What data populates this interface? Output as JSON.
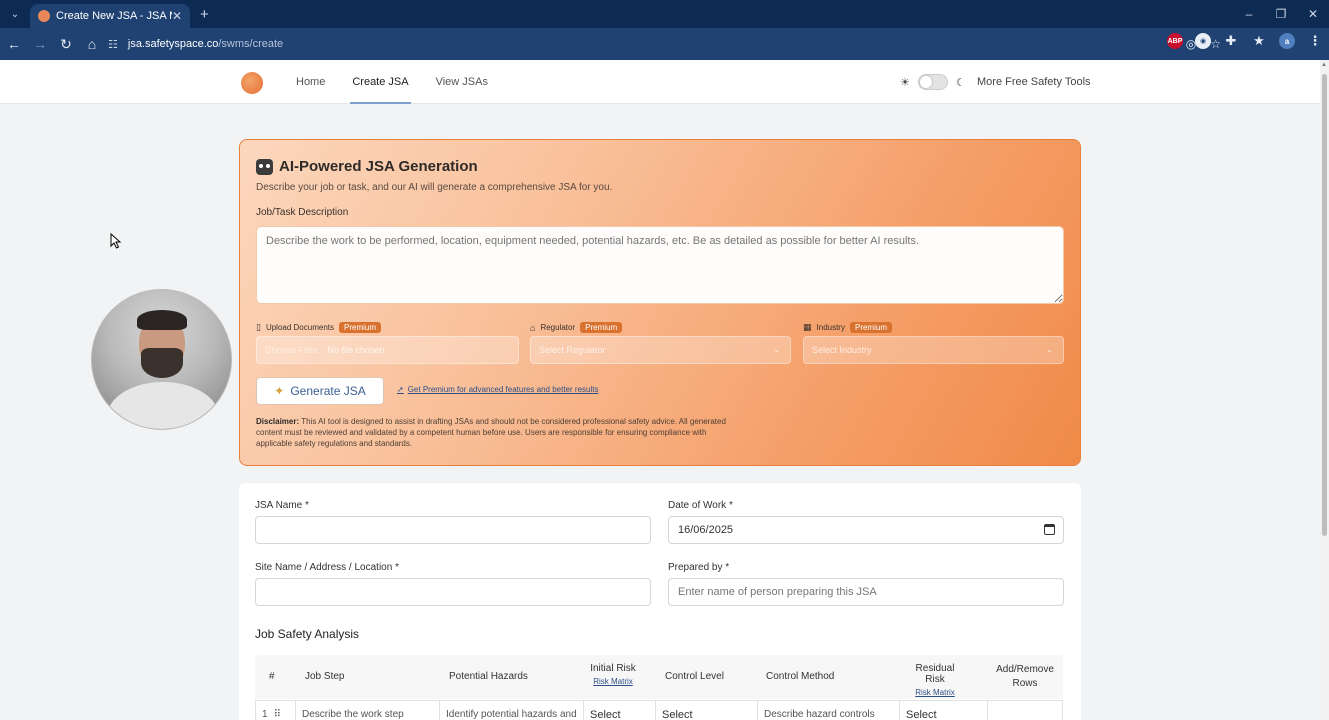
{
  "browser": {
    "tab_title": "Create New JSA - JSA Maker",
    "url_host": "jsa.safetyspace.co",
    "url_path": "/swms/create",
    "avatar_letter": "a",
    "ext_abp": "ABP"
  },
  "header": {
    "nav": [
      "Home",
      "Create JSA",
      "View JSAs"
    ],
    "active_nav": "Create JSA",
    "more_tools": "More Free Safety Tools",
    "sun_glyph": "☀",
    "moon_glyph": "☾"
  },
  "ai_card": {
    "title": "AI-Powered JSA Generation",
    "subtitle": "Describe your job or task, and our AI will generate a comprehensive JSA for you.",
    "task_label": "Job/Task Description",
    "task_placeholder": "Describe the work to be performed, location, equipment needed, potential hazards, etc. Be as detailed as possible for better AI results.",
    "upload_label": "Upload Documents",
    "regulator_label": "Regulator",
    "industry_label": "Industry",
    "premium_badge": "Premium",
    "choose_file": "Choose Files",
    "no_file": "No file chosen",
    "regulator_placeholder": "Select Regulator",
    "industry_placeholder": "Select Industry",
    "generate_button": "Generate JSA",
    "premium_link": "Get Premium for advanced features and better results",
    "disclaimer_label": "Disclaimer:",
    "disclaimer_text": "This AI tool is designed to assist in drafting JSAs and should not be considered professional safety advice. All generated content must be reviewed and validated by a competent human before use. Users are responsible for ensuring compliance with applicable safety regulations and standards."
  },
  "form": {
    "jsa_name_label": "JSA Name *",
    "jsa_name_value": "",
    "date_label": "Date of Work *",
    "date_value": "16/06/2025",
    "site_label": "Site Name / Address / Location *",
    "site_value": "",
    "prepared_label": "Prepared by *",
    "prepared_placeholder": "Enter name of person preparing this JSA",
    "section_title": "Job Safety Analysis",
    "columns": {
      "num": "#",
      "job_step": "Job Step",
      "hazards": "Potential Hazards",
      "initial_risk": "Initial Risk",
      "risk_matrix": "Risk Matrix",
      "control_level": "Control Level",
      "control_method": "Control Method",
      "residual_risk": "Residual Risk",
      "add_remove": "Add/Remove Rows"
    },
    "row1": {
      "num": "1",
      "job_step": "Describe the work step",
      "hazards": "Identify potential hazards and",
      "initial": "Select",
      "control_level": "Select",
      "control_method": "Describe hazard controls",
      "residual": "Select"
    }
  },
  "colors": {
    "brand_orange": "#e87f3c",
    "browser_bg": "#0c2a52",
    "link_blue": "#2d4f86"
  }
}
